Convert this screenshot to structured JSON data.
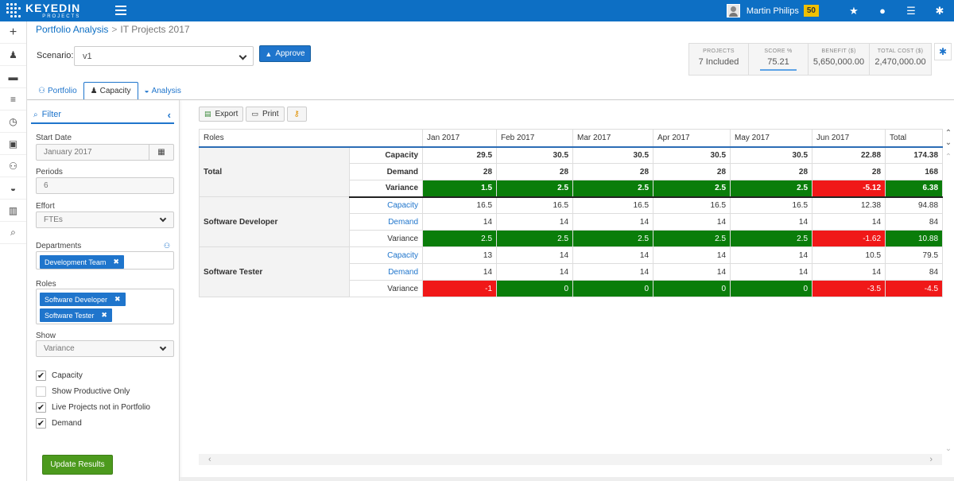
{
  "app": {
    "logo_name": "KEYEDIN",
    "logo_sub": "PROJECTS",
    "user_name": "Martin Philips",
    "user_badge": "50",
    "icons": [
      "star-icon",
      "globe-icon",
      "list-icon",
      "gear-icon"
    ]
  },
  "rail": {
    "icons": [
      "plus-icon",
      "person-icon",
      "briefcase-icon",
      "sliders-icon",
      "clock-icon",
      "money-icon",
      "sitemap-icon",
      "dashboard-icon",
      "bar-chart-icon",
      "search-icon"
    ]
  },
  "breadcrumb": {
    "parent": "Portfolio Analysis",
    "separator": ">",
    "current": "IT Projects 2017"
  },
  "scenario": {
    "label": "Scenario:",
    "value": "v1",
    "approve_label": "Approve"
  },
  "stats": [
    {
      "label": "PROJECTS",
      "value": "7 Included"
    },
    {
      "label": "SCORE %",
      "value": "75.21"
    },
    {
      "label": "BENEFIT ($)",
      "value": "5,650,000.00"
    },
    {
      "label": "TOTAL COST ($)",
      "value": "2,470,000.00"
    }
  ],
  "tabs": [
    {
      "label": "Portfolio",
      "icon": "sitemap-icon"
    },
    {
      "label": "Capacity",
      "icon": "person-icon"
    },
    {
      "label": "Analysis",
      "icon": "dashboard-icon"
    }
  ],
  "filter": {
    "title": "Filter",
    "start_date_label": "Start Date",
    "start_date_value": "January 2017",
    "periods_label": "Periods",
    "periods_value": "6",
    "effort_label": "Effort",
    "effort_value": "FTEs",
    "departments_label": "Departments",
    "departments": [
      "Development Team"
    ],
    "roles_label": "Roles",
    "roles": [
      "Software Developer",
      "Software Tester"
    ],
    "show_label": "Show",
    "show_value": "Variance",
    "checks": [
      {
        "label": "Capacity",
        "checked": true
      },
      {
        "label": "Show Productive Only",
        "checked": false
      },
      {
        "label": "Live Projects not in Portfolio",
        "checked": true
      },
      {
        "label": "Demand",
        "checked": true
      }
    ],
    "update_label": "Update Results"
  },
  "toolbar": {
    "export_label": "Export",
    "print_label": "Print"
  },
  "grid": {
    "roles_header": "Roles",
    "columns": [
      "Jan 2017",
      "Feb 2017",
      "Mar 2017",
      "Apr 2017",
      "May 2017",
      "Jun 2017",
      "Total"
    ],
    "groups": [
      {
        "role": "Total",
        "rows": [
          {
            "metric": "Capacity",
            "values": [
              "29.5",
              "30.5",
              "30.5",
              "30.5",
              "30.5",
              "22.88",
              "174.38"
            ]
          },
          {
            "metric": "Demand",
            "values": [
              "28",
              "28",
              "28",
              "28",
              "28",
              "28",
              "168"
            ]
          },
          {
            "metric": "Variance",
            "values": [
              "1.5",
              "2.5",
              "2.5",
              "2.5",
              "2.5",
              "-5.12",
              "6.38"
            ]
          }
        ]
      },
      {
        "role": "Software Developer",
        "rows": [
          {
            "metric": "Capacity",
            "values": [
              "16.5",
              "16.5",
              "16.5",
              "16.5",
              "16.5",
              "12.38",
              "94.88"
            ]
          },
          {
            "metric": "Demand",
            "values": [
              "14",
              "14",
              "14",
              "14",
              "14",
              "14",
              "84"
            ]
          },
          {
            "metric": "Variance",
            "values": [
              "2.5",
              "2.5",
              "2.5",
              "2.5",
              "2.5",
              "-1.62",
              "10.88"
            ]
          }
        ]
      },
      {
        "role": "Software Tester",
        "rows": [
          {
            "metric": "Capacity",
            "values": [
              "13",
              "14",
              "14",
              "14",
              "14",
              "10.5",
              "79.5"
            ]
          },
          {
            "metric": "Demand",
            "values": [
              "14",
              "14",
              "14",
              "14",
              "14",
              "14",
              "84"
            ]
          },
          {
            "metric": "Variance",
            "values": [
              "-1",
              "0",
              "0",
              "0",
              "0",
              "-3.5",
              "-4.5"
            ]
          }
        ]
      }
    ],
    "colors": {
      "positive": "#0a7d0a",
      "negative": "#f01818"
    }
  }
}
